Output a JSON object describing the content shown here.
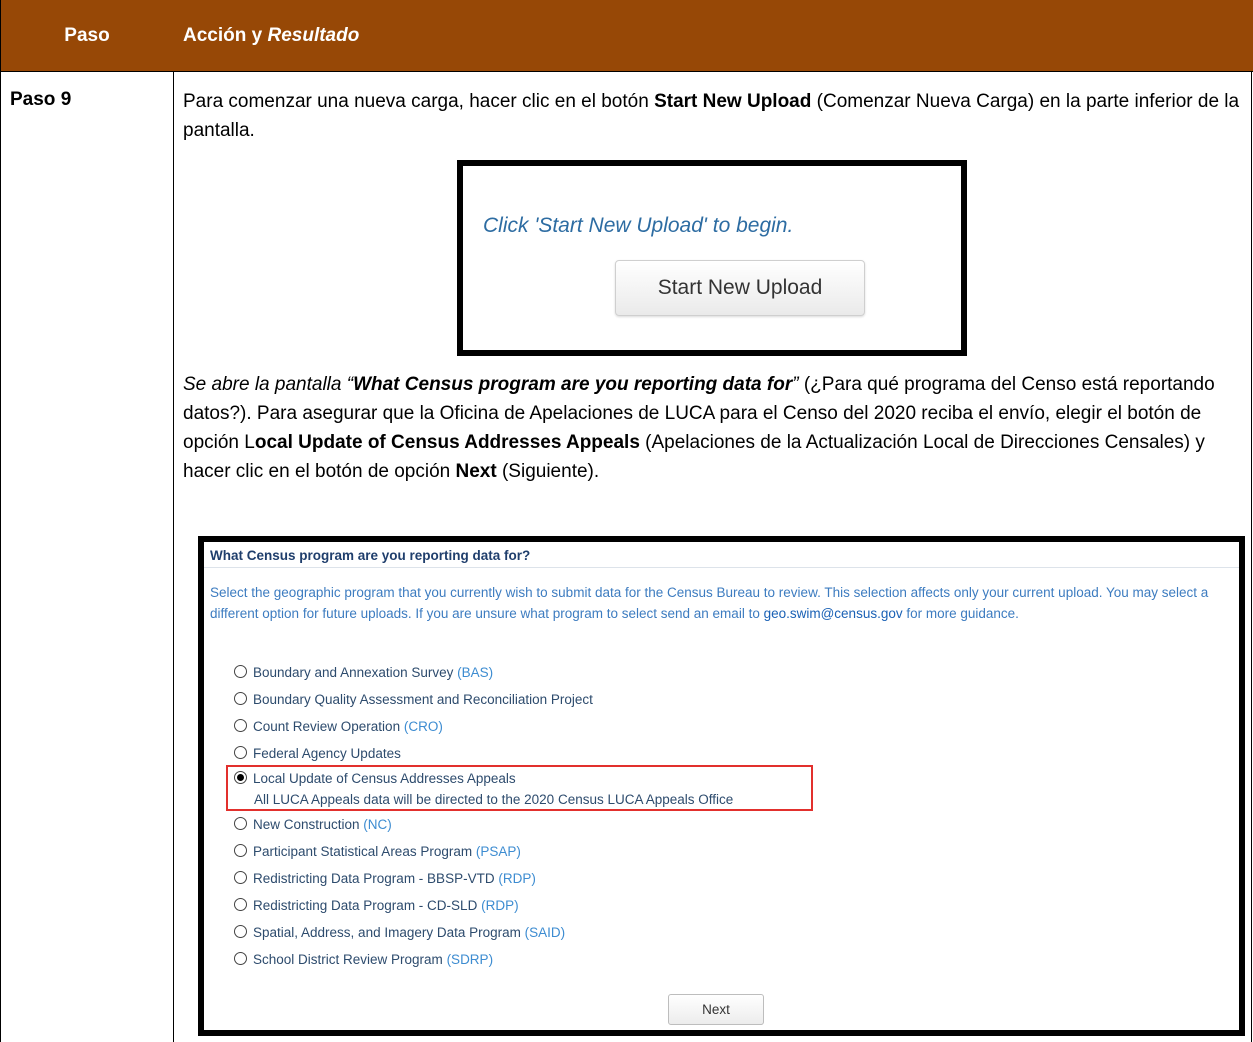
{
  "table": {
    "header": {
      "col1": "Paso",
      "col2_bold": "Acción y ",
      "col2_italic": "Resultado"
    },
    "step_label": "Paso 9",
    "para1": {
      "t1": "Para comenzar una nueva carga, hacer clic en el botón ",
      "b1": "Start New Upload",
      "t2": " (Comenzar Nueva Carga) en la parte inferior de la pantalla."
    },
    "para2": {
      "i1": "Se abre la pantalla “",
      "bi1": "What Census program are you reporting data for",
      "i2": "”",
      "t1": " (¿Para qué programa del Censo está reportando datos?). Para asegurar que la Oficina de Apelaciones de LUCA para el Censo del 2020 reciba el envío, elegir el botón de opción L",
      "b1": "ocal Update of Census Addresses Appeals",
      "t2": " (Apelaciones de la Actualización Local de Direcciones Censales) y hacer clic en el botón de opción ",
      "b2": "Next",
      "t3": " (Siguiente)."
    }
  },
  "shot1": {
    "message": "Click 'Start New Upload' to begin.",
    "button": "Start New Upload"
  },
  "shot2": {
    "title": "What Census program are you reporting data for?",
    "desc1": "Select the geographic program that you currently wish to submit data for the Census Bureau to review. This selection affects only your current upload. You may select a different option for future uploads. If you are unsure what program to select send an email to ",
    "email": "geo.swim@census.gov",
    "desc2": " for more guidance.",
    "options": [
      {
        "label": "Boundary and Annexation Survey ",
        "abbr": "(BAS)"
      },
      {
        "label": "Boundary Quality Assessment and Reconciliation Project",
        "abbr": ""
      },
      {
        "label": "Count Review Operation ",
        "abbr": "(CRO)"
      },
      {
        "label": "Federal Agency Updates",
        "abbr": ""
      },
      {
        "label": "Local Update of Census Addresses Appeals",
        "abbr": ""
      },
      {
        "label": "New Construction ",
        "abbr": "(NC)"
      },
      {
        "label": "Participant Statistical Areas Program ",
        "abbr": "(PSAP)"
      },
      {
        "label": "Redistricting Data Program - BBSP-VTD ",
        "abbr": "(RDP)"
      },
      {
        "label": "Redistricting Data Program - CD-SLD ",
        "abbr": "(RDP)"
      },
      {
        "label": "Spatial, Address, and Imagery Data Program ",
        "abbr": "(SAID)"
      },
      {
        "label": "School District Review Program ",
        "abbr": "(SDRP)"
      }
    ],
    "selected_note": "All LUCA Appeals data will be directed to the 2020 Census LUCA Appeals Office",
    "next_button": "Next"
  }
}
